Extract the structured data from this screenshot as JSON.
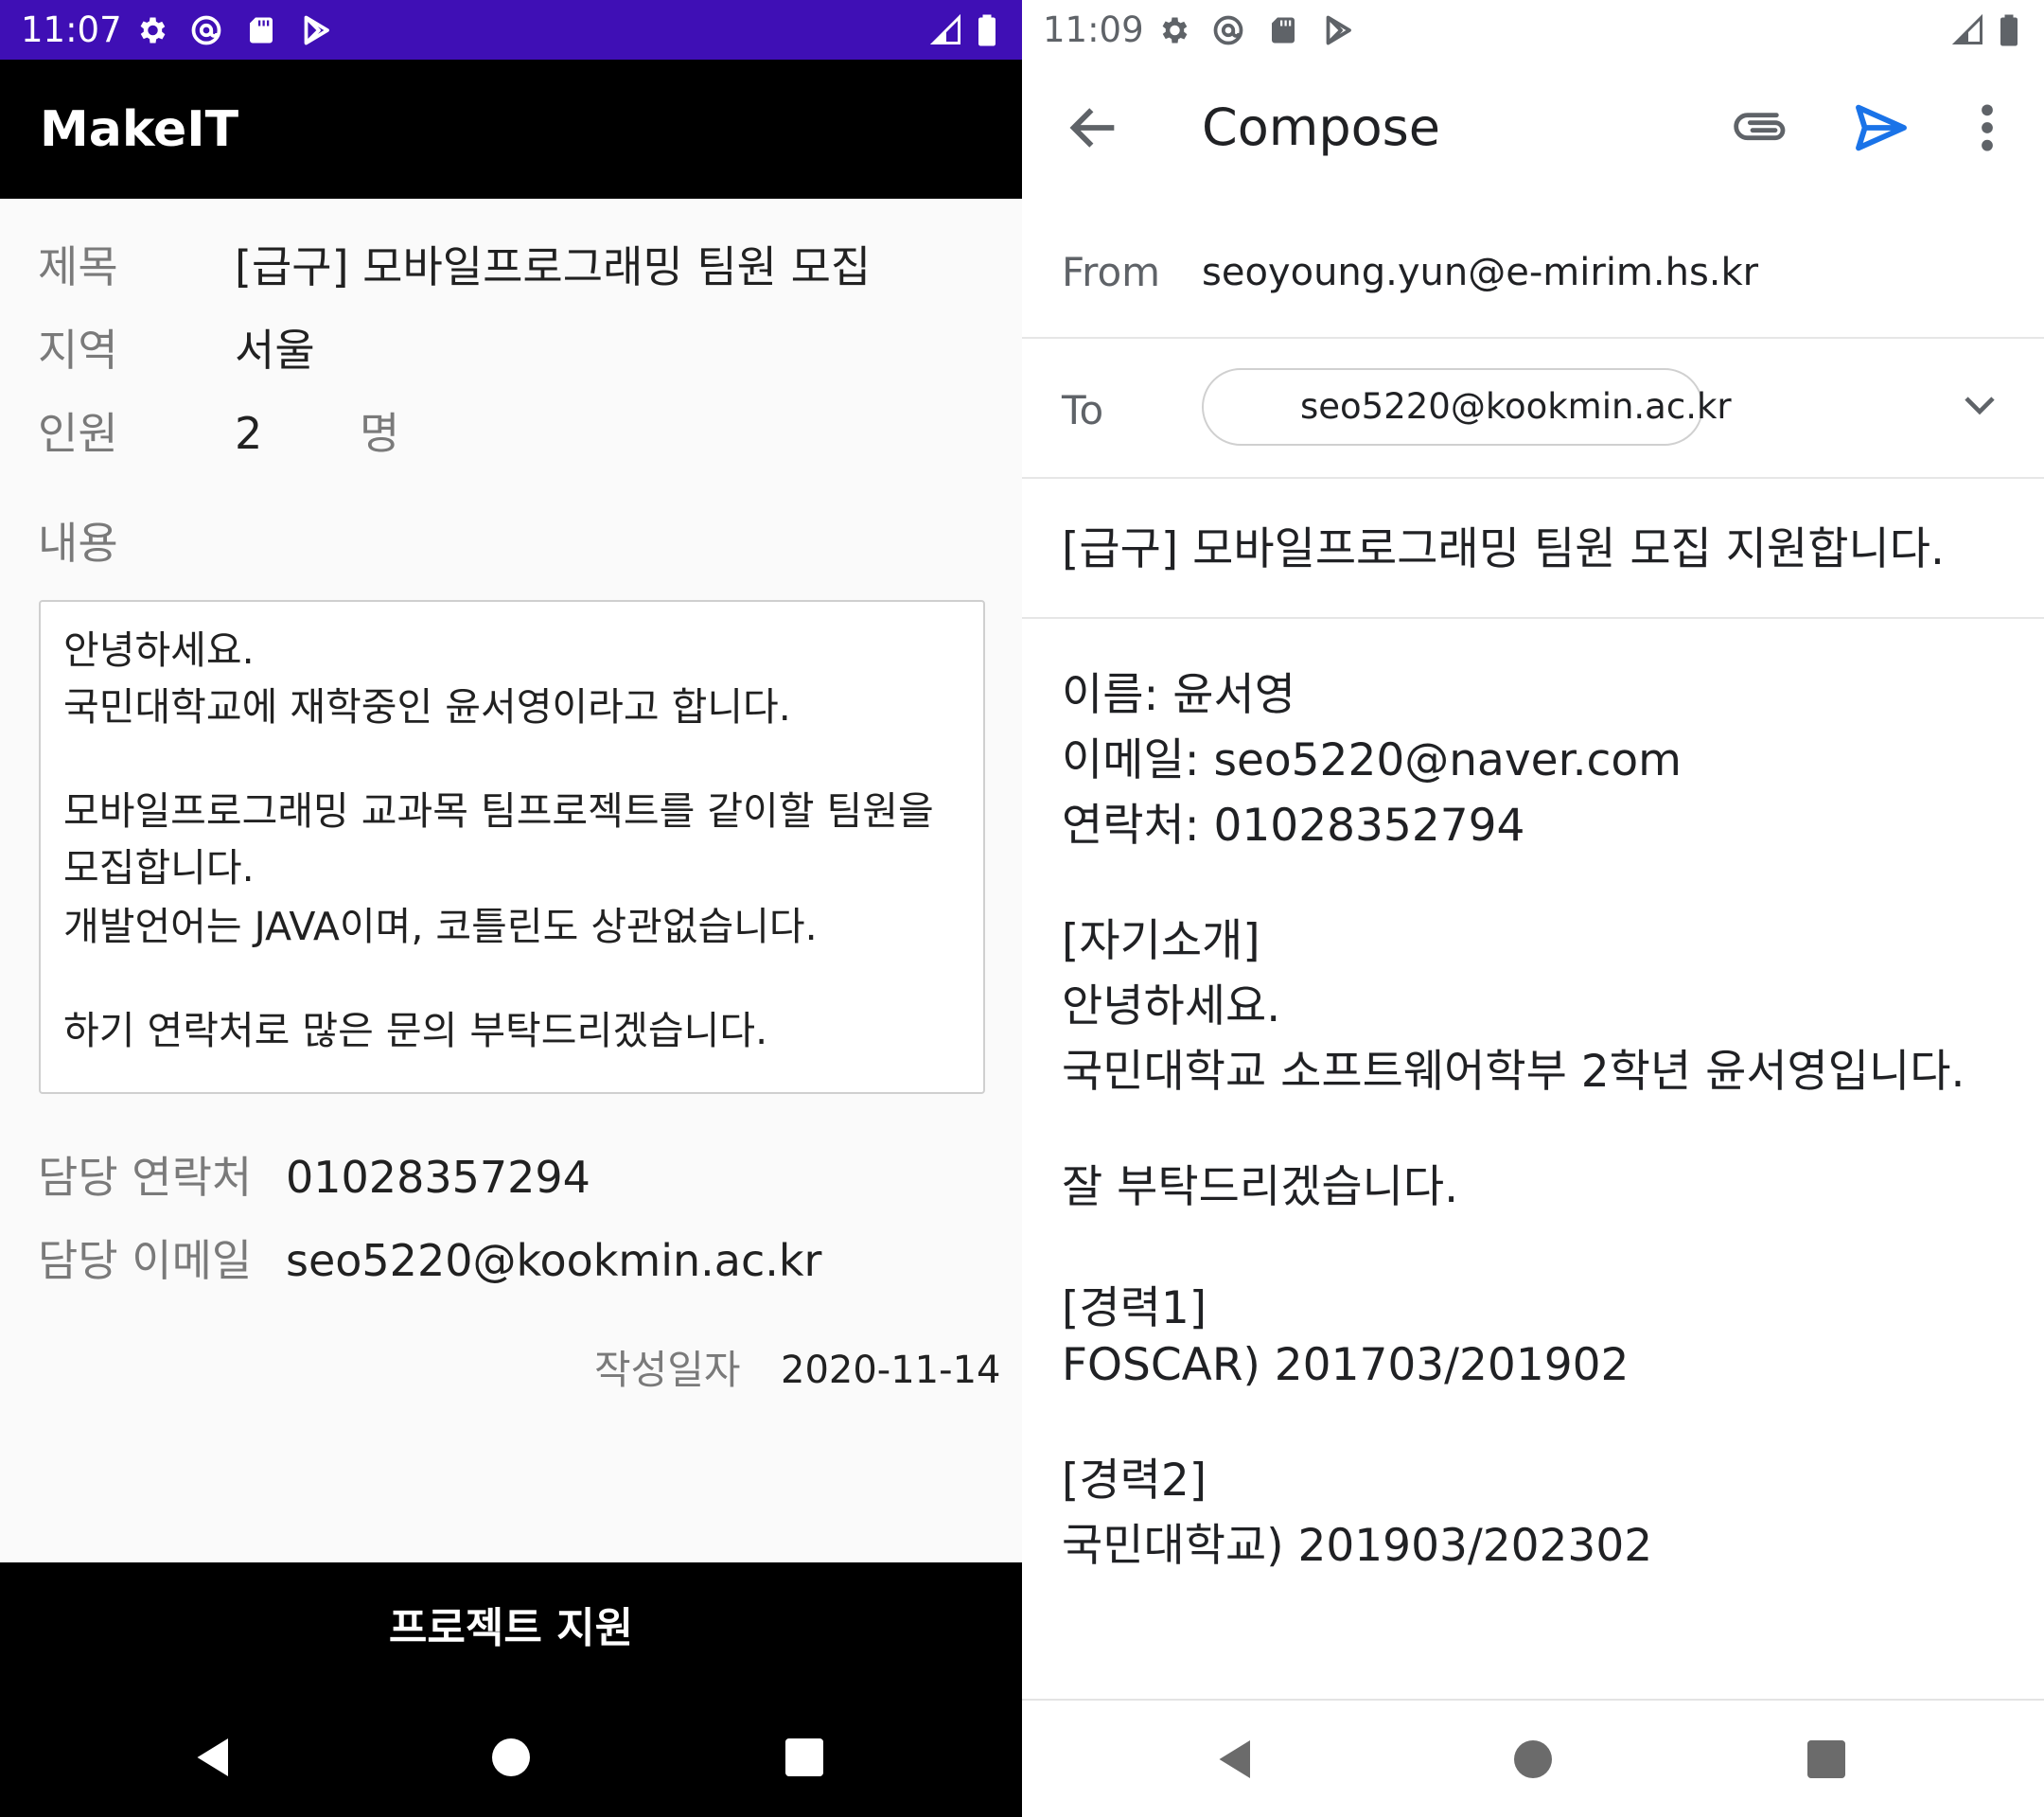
{
  "left": {
    "status": {
      "time": "11:07"
    },
    "app_title": "MakeIT",
    "fields": {
      "title_label": "제목",
      "title_value": "[급구] 모바일프로그래밍 팀원 모집",
      "region_label": "지역",
      "region_value": "서울",
      "people_label": "인원",
      "people_value": "2",
      "people_unit": "명",
      "content_label": "내용"
    },
    "content_lines": [
      "안녕하세요.",
      "국민대학교에 재학중인 윤서영이라고 합니다.",
      "모바일프로그래밍 교과목 팀프로젝트를 같이할 팀원을",
      "모집합니다.",
      "개발언어는 JAVA이며, 코틀린도 상관없습니다.",
      "하기 연락처로 많은 문의 부탁드리겠습니다."
    ],
    "contact_label": "담당 연락처",
    "contact_value": "01028357294",
    "email_label": "담당 이메일",
    "email_value": "seo5220@kookmin.ac.kr",
    "date_label": "작성일자",
    "date_value": "2020-11-14",
    "apply_button": "프로젝트 지원"
  },
  "right": {
    "status": {
      "time": "11:09"
    },
    "compose_title": "Compose",
    "from_label": "From",
    "from_value": "seoyoung.yun@e-mirim.hs.kr",
    "to_label": "To",
    "to_value": "seo5220@kookmin.ac.kr",
    "subject": "[급구] 모바일프로그래밍 팀원 모집 지원합니다.",
    "body_lines": [
      "이름: 윤서영",
      "이메일: seo5220@naver.com",
      "연락처: 01028352794",
      "[자기소개]",
      "안녕하세요.",
      "국민대학교 소프트웨어학부 2학년 윤서영입니다.",
      "잘 부탁드리겠습니다.",
      "[경력1]",
      "FOSCAR) 201703/201902",
      "[경력2]",
      "국민대학교) 201903/202302"
    ]
  },
  "colors": {
    "status_bar_left": "#3f0fb5",
    "app_bar": "#000000",
    "send_icon": "#1a73e8"
  },
  "icons": [
    "gear-icon",
    "at-sign-icon",
    "sd-card-icon",
    "play-store-icon",
    "signal-icon",
    "battery-icon",
    "back-arrow-icon",
    "paperclip-icon",
    "send-icon",
    "more-vert-icon",
    "chevron-down-icon",
    "nav-back-icon",
    "nav-home-icon",
    "nav-recents-icon"
  ]
}
